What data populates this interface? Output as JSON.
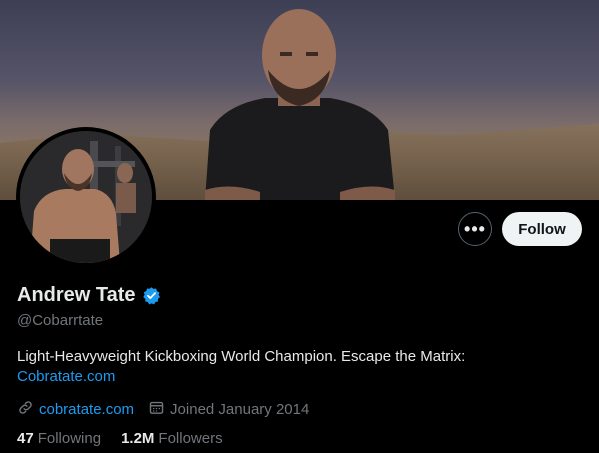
{
  "profile": {
    "display_name": "Andrew Tate",
    "handle": "@Cobarrtate",
    "bio_text": "Light-Heavyweight Kickboxing World Champion. Escape the Matrix:",
    "bio_link": "Cobratate.com",
    "website": "cobratate.com",
    "joined": "Joined January 2014",
    "following_count": "47",
    "following_label": "Following",
    "followers_count": "1.2M",
    "followers_label": "Followers",
    "verified": true
  },
  "actions": {
    "more_label": "•••",
    "follow_label": "Follow"
  },
  "icons": {
    "more": "more-horizontal-icon",
    "verified": "verified-badge-icon",
    "link": "link-icon",
    "calendar": "calendar-icon"
  },
  "colors": {
    "background": "#000000",
    "text_primary": "#e7e9ea",
    "text_secondary": "#71767b",
    "accent": "#1d9bf0",
    "follow_button_bg": "#eff3f4"
  }
}
